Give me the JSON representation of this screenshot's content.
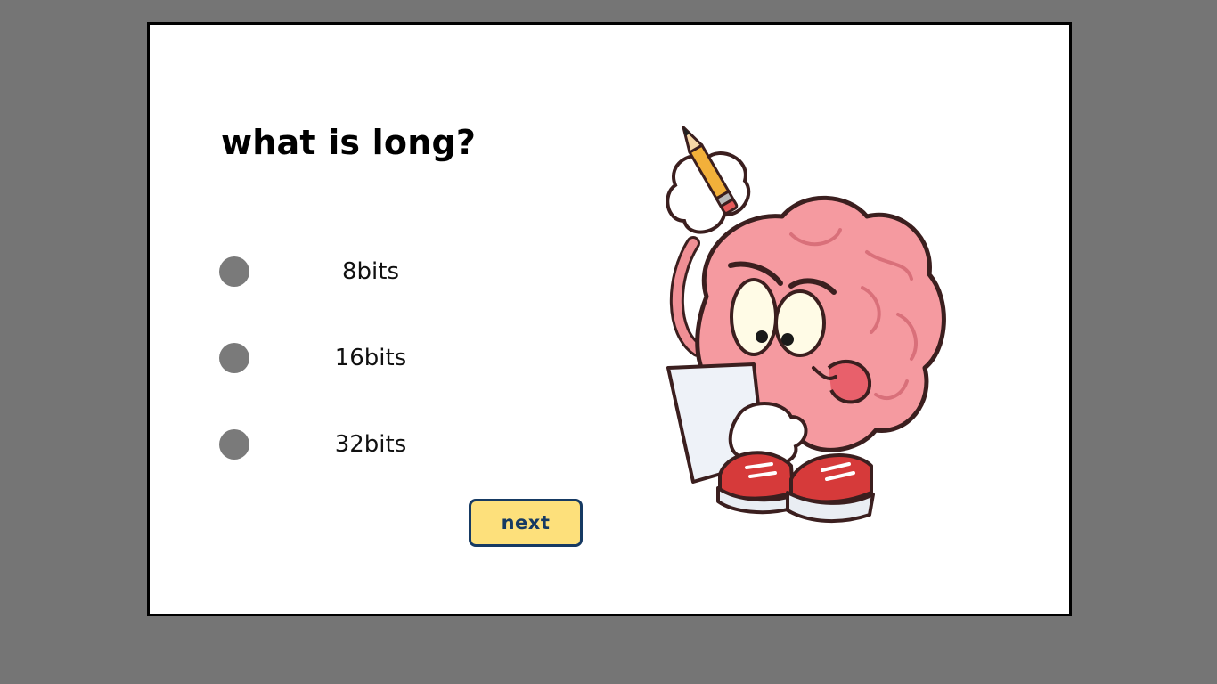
{
  "quiz": {
    "question": "what is long?",
    "options": [
      {
        "label": "8bits"
      },
      {
        "label": "16bits"
      },
      {
        "label": "32bits"
      }
    ],
    "next_label": "next"
  },
  "illustration": {
    "icon": "thinking-brain-cartoon"
  },
  "colors": {
    "background": "#757575",
    "card": "#ffffff",
    "card_border": "#000000",
    "radio": "#7a7a7a",
    "button_fill": "#fde07b",
    "button_border": "#163a63",
    "button_text": "#163a63"
  }
}
